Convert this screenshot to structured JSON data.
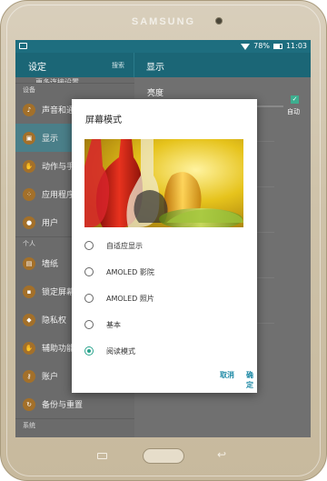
{
  "device": {
    "brand": "SAMSUNG"
  },
  "status_bar": {
    "battery": "78%",
    "time": "11:03"
  },
  "app_bar": {
    "title": "设定",
    "search": "搜索",
    "detail_title": "显示"
  },
  "sidebar": {
    "partial_top": "更多连接设置",
    "section_device": "设备",
    "items_device": [
      {
        "label": "声音和通知",
        "icon": "sound-icon"
      },
      {
        "label": "显示",
        "icon": "display-icon",
        "selected": true
      },
      {
        "label": "动作与手势",
        "icon": "motion-icon"
      },
      {
        "label": "应用程序",
        "icon": "apps-icon"
      },
      {
        "label": "用户",
        "icon": "user-icon"
      }
    ],
    "section_personal": "个人",
    "items_personal": [
      {
        "label": "墙纸",
        "icon": "wallpaper-icon"
      },
      {
        "label": "锁定屏幕",
        "icon": "lock-icon"
      },
      {
        "label": "隐私权",
        "icon": "privacy-icon"
      },
      {
        "label": "辅助功能",
        "icon": "accessibility-icon"
      },
      {
        "label": "账户",
        "icon": "key-icon"
      },
      {
        "label": "备份与重置",
        "icon": "backup-icon"
      }
    ],
    "section_system": "系统"
  },
  "detail": {
    "brightness_label": "亮度",
    "auto_label": "自动"
  },
  "dialog": {
    "title": "屏幕模式",
    "options": [
      {
        "label": "自适应显示",
        "selected": false
      },
      {
        "label": "AMOLED 影院",
        "selected": false
      },
      {
        "label": "AMOLED 照片",
        "selected": false
      },
      {
        "label": "基本",
        "selected": false
      },
      {
        "label": "阅读模式",
        "selected": true
      }
    ],
    "cancel": "取消",
    "confirm": "确定"
  },
  "colors": {
    "accent": "#2aa48d",
    "appbar": "#1b6676",
    "button_text": "#1f8aa6"
  }
}
